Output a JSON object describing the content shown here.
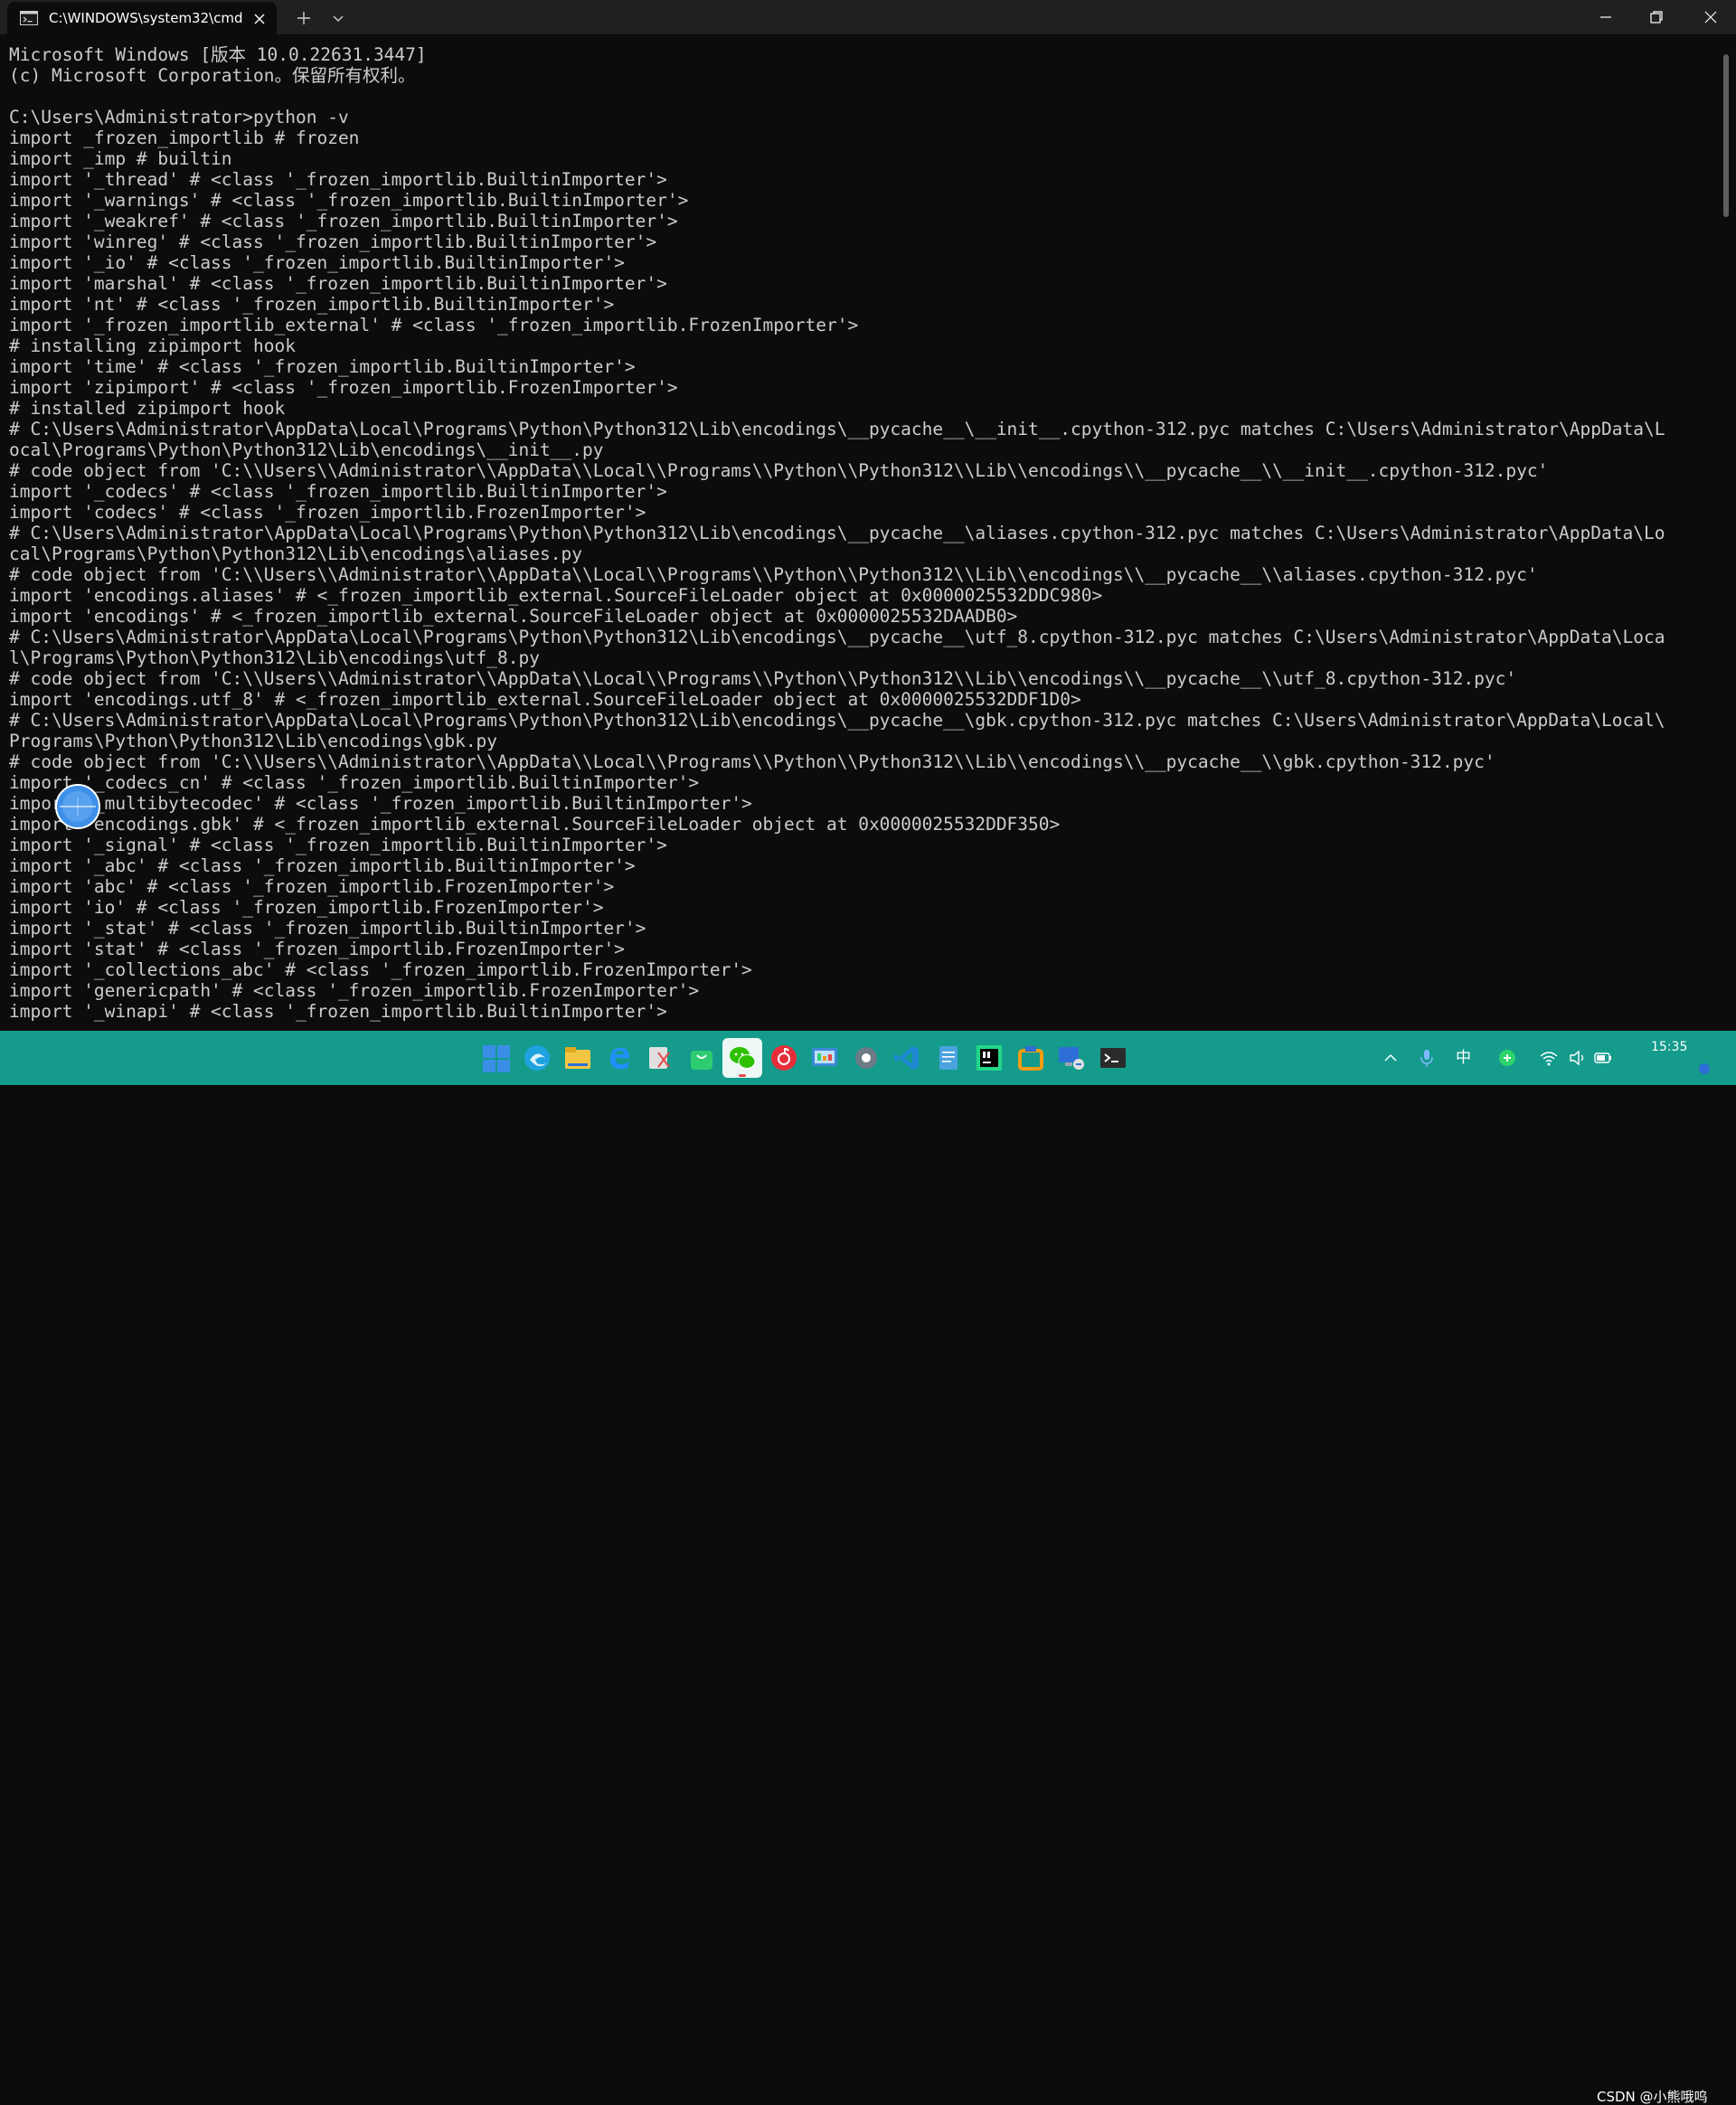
{
  "window": {
    "tab_title": "C:\\WINDOWS\\system32\\cmd.",
    "background_color": "#0c0c0c",
    "titlebar_color": "#202020",
    "text_color": "#cccccc"
  },
  "console": {
    "lines": [
      "Microsoft Windows [版本 10.0.22631.3447]",
      "(c) Microsoft Corporation。保留所有权利。",
      "",
      "C:\\Users\\Administrator>python -v",
      "import _frozen_importlib # frozen",
      "import _imp # builtin",
      "import '_thread' # <class '_frozen_importlib.BuiltinImporter'>",
      "import '_warnings' # <class '_frozen_importlib.BuiltinImporter'>",
      "import '_weakref' # <class '_frozen_importlib.BuiltinImporter'>",
      "import 'winreg' # <class '_frozen_importlib.BuiltinImporter'>",
      "import '_io' # <class '_frozen_importlib.BuiltinImporter'>",
      "import 'marshal' # <class '_frozen_importlib.BuiltinImporter'>",
      "import 'nt' # <class '_frozen_importlib.BuiltinImporter'>",
      "import '_frozen_importlib_external' # <class '_frozen_importlib.FrozenImporter'>",
      "# installing zipimport hook",
      "import 'time' # <class '_frozen_importlib.BuiltinImporter'>",
      "import 'zipimport' # <class '_frozen_importlib.FrozenImporter'>",
      "# installed zipimport hook",
      "# C:\\Users\\Administrator\\AppData\\Local\\Programs\\Python\\Python312\\Lib\\encodings\\__pycache__\\__init__.cpython-312.pyc matches C:\\Users\\Administrator\\AppData\\L",
      "ocal\\Programs\\Python\\Python312\\Lib\\encodings\\__init__.py",
      "# code object from 'C:\\\\Users\\\\Administrator\\\\AppData\\\\Local\\\\Programs\\\\Python\\\\Python312\\\\Lib\\\\encodings\\\\__pycache__\\\\__init__.cpython-312.pyc'",
      "import '_codecs' # <class '_frozen_importlib.BuiltinImporter'>",
      "import 'codecs' # <class '_frozen_importlib.FrozenImporter'>",
      "# C:\\Users\\Administrator\\AppData\\Local\\Programs\\Python\\Python312\\Lib\\encodings\\__pycache__\\aliases.cpython-312.pyc matches C:\\Users\\Administrator\\AppData\\Lo",
      "cal\\Programs\\Python\\Python312\\Lib\\encodings\\aliases.py",
      "# code object from 'C:\\\\Users\\\\Administrator\\\\AppData\\\\Local\\\\Programs\\\\Python\\\\Python312\\\\Lib\\\\encodings\\\\__pycache__\\\\aliases.cpython-312.pyc'",
      "import 'encodings.aliases' # <_frozen_importlib_external.SourceFileLoader object at 0x0000025532DDC980>",
      "import 'encodings' # <_frozen_importlib_external.SourceFileLoader object at 0x0000025532DAADB0>",
      "# C:\\Users\\Administrator\\AppData\\Local\\Programs\\Python\\Python312\\Lib\\encodings\\__pycache__\\utf_8.cpython-312.pyc matches C:\\Users\\Administrator\\AppData\\Loca",
      "l\\Programs\\Python\\Python312\\Lib\\encodings\\utf_8.py",
      "# code object from 'C:\\\\Users\\\\Administrator\\\\AppData\\\\Local\\\\Programs\\\\Python\\\\Python312\\\\Lib\\\\encodings\\\\__pycache__\\\\utf_8.cpython-312.pyc'",
      "import 'encodings.utf_8' # <_frozen_importlib_external.SourceFileLoader object at 0x0000025532DDF1D0>",
      "# C:\\Users\\Administrator\\AppData\\Local\\Programs\\Python\\Python312\\Lib\\encodings\\__pycache__\\gbk.cpython-312.pyc matches C:\\Users\\Administrator\\AppData\\Local\\",
      "Programs\\Python\\Python312\\Lib\\encodings\\gbk.py",
      "# code object from 'C:\\\\Users\\\\Administrator\\\\AppData\\\\Local\\\\Programs\\\\Python\\\\Python312\\\\Lib\\\\encodings\\\\__pycache__\\\\gbk.cpython-312.pyc'",
      "import '_codecs_cn' # <class '_frozen_importlib.BuiltinImporter'>",
      "import '_multibytecodec' # <class '_frozen_importlib.BuiltinImporter'>",
      "import 'encodings.gbk' # <_frozen_importlib_external.SourceFileLoader object at 0x0000025532DDF350>",
      "import '_signal' # <class '_frozen_importlib.BuiltinImporter'>",
      "import '_abc' # <class '_frozen_importlib.BuiltinImporter'>",
      "import 'abc' # <class '_frozen_importlib.FrozenImporter'>",
      "import 'io' # <class '_frozen_importlib.FrozenImporter'>",
      "import '_stat' # <class '_frozen_importlib.BuiltinImporter'>",
      "import 'stat' # <class '_frozen_importlib.FrozenImporter'>",
      "import '_collections_abc' # <class '_frozen_importlib.FrozenImporter'>",
      "import 'genericpath' # <class '_frozen_importlib.FrozenImporter'>",
      "import '_winapi' # <class '_frozen_importlib.BuiltinImporter'>"
    ]
  },
  "taskbar": {
    "color": "#149b8c",
    "apps": [
      {
        "name": "start-icon",
        "color": "#3a8ee6"
      },
      {
        "name": "edge-icon",
        "color": "#1fa3e0"
      },
      {
        "name": "file-explorer-icon",
        "color": "#f4c542"
      },
      {
        "name": "ie-icon",
        "color": "#1e90ff"
      },
      {
        "name": "snipping-tool-icon",
        "color": "#e0e0e0"
      },
      {
        "name": "shopping-bag-icon",
        "color": "#2ecc71"
      },
      {
        "name": "wechat-icon",
        "color": "#2dc100"
      },
      {
        "name": "netease-music-icon",
        "color": "#e62e3a"
      },
      {
        "name": "control-panel-icon",
        "color": "#3b8ad9"
      },
      {
        "name": "settings-icon",
        "color": "#6d7b86"
      },
      {
        "name": "vscode-icon",
        "color": "#1f8ad2"
      },
      {
        "name": "notepad-icon",
        "color": "#4aa3df"
      },
      {
        "name": "pycharm-icon",
        "color": "#21d789"
      },
      {
        "name": "app-orange-icon",
        "color": "#f39c12"
      },
      {
        "name": "remote-desktop-icon",
        "color": "#2d6fd6"
      },
      {
        "name": "terminal-icon",
        "color": "#2b2b2b"
      }
    ],
    "tray": {
      "ime_label": "中",
      "time": "15:35"
    },
    "watermark": "CSDN @小熊哦呜"
  }
}
